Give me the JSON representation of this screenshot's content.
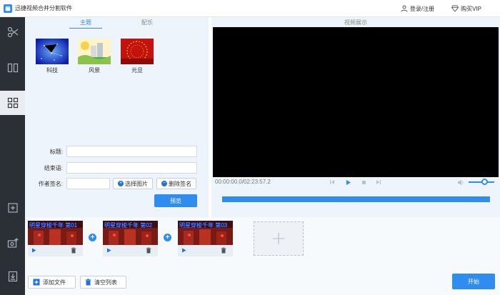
{
  "app": {
    "title": "迅捷视频合并分割软件"
  },
  "header": {
    "login_label": "登录/注册",
    "vip_label": "购买VIP"
  },
  "sidebar": {
    "items": [
      {
        "icon": "scissors-icon"
      },
      {
        "icon": "split-columns-icon"
      },
      {
        "icon": "grid-icon",
        "active": true
      },
      {
        "icon": "add-file-icon"
      },
      {
        "icon": "add-camera-icon"
      },
      {
        "icon": "document-download-icon"
      }
    ]
  },
  "topic_panel": {
    "tabs": [
      {
        "label": "主题",
        "active": true
      },
      {
        "label": "配乐",
        "active": false
      }
    ],
    "themes": [
      {
        "label": "科技"
      },
      {
        "label": "风景"
      },
      {
        "label": "元旦"
      }
    ]
  },
  "form": {
    "title_label": "标题:",
    "title_value": "",
    "ending_label": "结束语:",
    "ending_value": "",
    "author_label": "作者签名:",
    "author_value": "",
    "select_image_label": "选择图片",
    "delete_sign_label": "删除签名",
    "preview_label": "预览"
  },
  "player": {
    "panel_label": "视频展示",
    "time_display": "00:00:00.0/02:23:57.2",
    "progress": 1.0,
    "volume": 0.6
  },
  "clips": [
    {
      "name": "明星穿梭千年 第01"
    },
    {
      "name": "明星穿梭千年 第02"
    },
    {
      "name": "明星穿梭千年 第03"
    }
  ],
  "bottom": {
    "add_file_label": "添加文件",
    "clear_list_label": "清空列表",
    "start_label": "开始"
  },
  "colors": {
    "accent": "#2f8cf0",
    "sidebar_bg": "#2b2f36",
    "panel_bg": "#eef4fb"
  }
}
